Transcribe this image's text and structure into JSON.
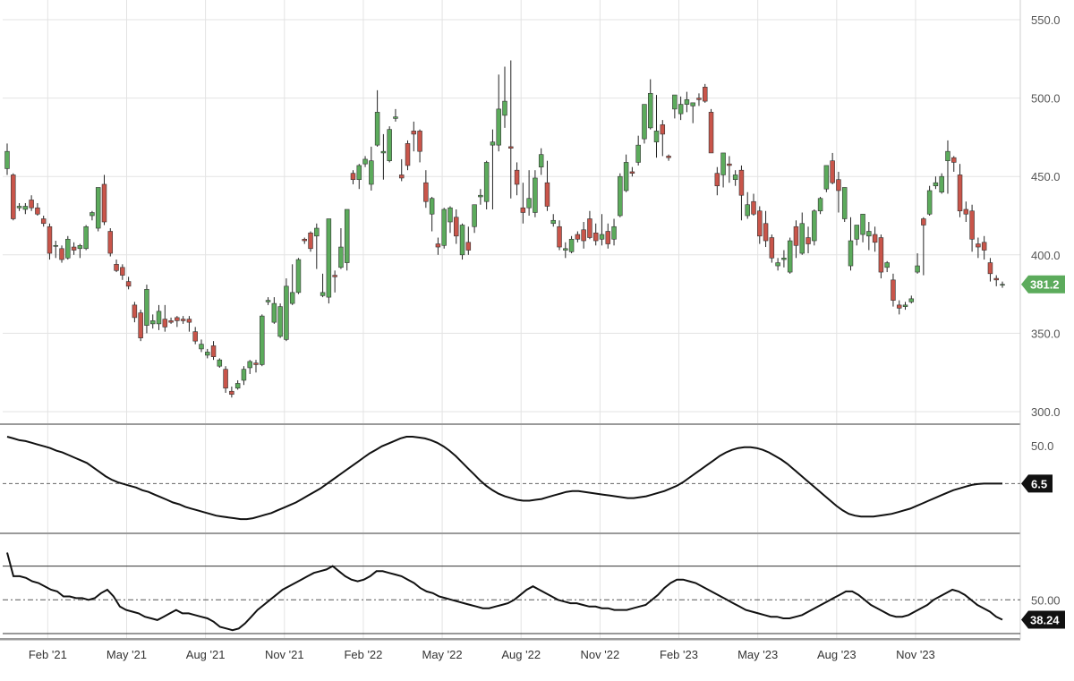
{
  "chart_data": {
    "type": "candlestick",
    "x_ticks": [
      "Feb '21",
      "May '21",
      "Aug '21",
      "Nov '21",
      "Feb '22",
      "May '22",
      "Aug '22",
      "Nov '22",
      "Feb '23",
      "May '23",
      "Aug '23",
      "Nov '23"
    ],
    "x_tick_week_index": [
      3,
      16,
      29,
      42,
      55,
      68,
      81,
      94,
      107,
      120,
      133,
      146
    ],
    "colors": {
      "up": "#5cab5c",
      "down": "#c9554a",
      "wick": "#222222",
      "grid": "#e3e3e3",
      "line": "#111111",
      "last_price_bg": "#5cab5c"
    },
    "price_panel": {
      "ylim": [
        300,
        550
      ],
      "y_ticks": [
        "550.0",
        "500.0",
        "450.0",
        "400.0",
        "350.0",
        "300.0"
      ],
      "last_price_label": "381.2",
      "weekly_candles": [
        [
          455,
          471,
          451,
          466
        ],
        [
          451,
          452,
          422,
          423
        ],
        [
          430,
          433,
          428,
          431
        ],
        [
          429,
          433,
          426,
          431
        ],
        [
          435,
          438,
          428,
          430
        ],
        [
          430,
          433,
          425,
          426
        ],
        [
          423,
          425,
          418,
          420
        ],
        [
          418,
          420,
          397,
          401
        ],
        [
          406,
          409,
          398,
          406
        ],
        [
          404,
          406,
          395,
          397
        ],
        [
          398,
          412,
          397,
          410
        ],
        [
          405,
          408,
          400,
          403
        ],
        [
          404,
          407,
          398,
          406
        ],
        [
          404,
          419,
          403,
          418
        ],
        [
          425,
          428,
          422,
          427
        ],
        [
          417,
          443,
          415,
          443
        ],
        [
          445,
          451,
          419,
          421
        ],
        [
          415,
          417,
          399,
          401
        ],
        [
          394,
          397,
          389,
          390
        ],
        [
          392,
          394,
          384,
          387
        ],
        [
          383,
          386,
          378,
          380
        ],
        [
          368,
          370,
          357,
          360
        ],
        [
          363,
          365,
          345,
          347
        ],
        [
          355,
          381,
          350,
          378
        ],
        [
          356,
          362,
          353,
          358
        ],
        [
          356,
          368,
          352,
          364
        ],
        [
          359,
          368,
          351,
          354
        ],
        [
          358,
          360,
          356,
          357
        ],
        [
          360,
          361,
          354,
          358
        ],
        [
          359,
          361,
          356,
          358
        ],
        [
          359,
          361,
          351,
          357
        ],
        [
          351,
          354,
          343,
          345
        ],
        [
          340,
          346,
          338,
          343
        ],
        [
          336,
          340,
          334,
          338
        ],
        [
          342,
          345,
          333,
          335
        ],
        [
          329,
          334,
          328,
          333
        ],
        [
          327,
          329,
          312,
          315
        ],
        [
          313,
          316,
          309,
          311
        ],
        [
          315,
          320,
          314,
          318
        ],
        [
          320,
          329,
          317,
          327
        ],
        [
          328,
          333,
          324,
          332
        ],
        [
          331,
          333,
          325,
          330
        ],
        [
          330,
          362,
          329,
          361
        ],
        [
          370,
          373,
          368,
          371
        ],
        [
          357,
          373,
          356,
          369
        ],
        [
          348,
          369,
          347,
          367
        ],
        [
          346,
          385,
          345,
          380
        ],
        [
          369,
          394,
          368,
          376
        ],
        [
          376,
          398,
          375,
          397
        ],
        [
          410,
          411,
          407,
          409
        ],
        [
          414,
          415,
          402,
          404
        ],
        [
          412,
          420,
          391,
          417
        ],
        [
          374,
          388,
          373,
          376
        ],
        [
          373,
          423,
          369,
          423
        ],
        [
          387,
          390,
          376,
          386
        ],
        [
          392,
          417,
          391,
          405
        ],
        [
          395,
          429,
          390,
          429
        ],
        [
          452,
          454,
          445,
          448
        ],
        [
          448,
          458,
          442,
          457
        ],
        [
          458,
          463,
          456,
          461
        ],
        [
          445,
          469,
          441,
          460
        ],
        [
          470,
          505,
          469,
          491
        ],
        [
          465,
          477,
          448,
          466
        ],
        [
          460,
          482,
          459,
          480
        ],
        [
          487,
          493,
          485,
          488
        ],
        [
          451,
          461,
          447,
          449
        ],
        [
          471,
          473,
          454,
          457
        ],
        [
          479,
          485,
          466,
          477
        ],
        [
          479,
          480,
          459,
          466
        ],
        [
          446,
          454,
          430,
          434
        ],
        [
          426,
          437,
          415,
          436
        ],
        [
          407,
          411,
          400,
          405
        ],
        [
          406,
          430,
          404,
          429
        ],
        [
          421,
          431,
          414,
          430
        ],
        [
          424,
          429,
          407,
          412
        ],
        [
          400,
          420,
          397,
          419
        ],
        [
          408,
          418,
          400,
          403
        ],
        [
          418,
          431,
          414,
          432
        ],
        [
          437,
          442,
          432,
          438
        ],
        [
          434,
          460,
          429,
          459
        ],
        [
          470,
          480,
          429,
          472
        ],
        [
          470,
          515,
          466,
          493
        ],
        [
          489,
          520,
          481,
          498
        ],
        [
          469,
          524,
          436,
          468
        ],
        [
          454,
          459,
          438,
          445
        ],
        [
          430,
          446,
          420,
          427
        ],
        [
          430,
          454,
          425,
          436
        ],
        [
          427,
          454,
          424,
          449
        ],
        [
          456,
          468,
          451,
          464
        ],
        [
          446,
          460,
          428,
          431
        ],
        [
          420,
          426,
          418,
          422
        ],
        [
          418,
          422,
          403,
          405
        ],
        [
          403,
          408,
          398,
          404
        ],
        [
          402,
          412,
          401,
          410
        ],
        [
          413,
          415,
          408,
          410
        ],
        [
          416,
          421,
          404,
          409
        ],
        [
          423,
          428,
          410,
          411
        ],
        [
          414,
          420,
          406,
          409
        ],
        [
          410,
          426,
          406,
          413
        ],
        [
          415,
          420,
          404,
          407
        ],
        [
          410,
          423,
          406,
          418
        ],
        [
          425,
          452,
          424,
          450
        ],
        [
          441,
          464,
          440,
          459
        ],
        [
          453,
          456,
          450,
          452
        ],
        [
          459,
          476,
          457,
          470
        ],
        [
          474,
          492,
          471,
          496
        ],
        [
          481,
          512,
          480,
          503
        ],
        [
          472,
          502,
          462,
          479
        ],
        [
          483,
          486,
          463,
          477
        ],
        [
          463,
          464,
          460,
          462
        ],
        [
          493,
          498,
          487,
          502
        ],
        [
          490,
          501,
          486,
          496
        ],
        [
          496,
          504,
          491,
          499
        ],
        [
          495,
          497,
          484,
          497
        ],
        [
          500,
          503,
          495,
          499
        ],
        [
          507,
          509,
          497,
          498
        ],
        [
          491,
          493,
          466,
          465
        ],
        [
          452,
          456,
          438,
          444
        ],
        [
          451,
          462,
          443,
          465
        ],
        [
          458,
          463,
          446,
          457
        ],
        [
          448,
          454,
          444,
          451
        ],
        [
          454,
          457,
          422,
          438
        ],
        [
          425,
          440,
          423,
          432
        ],
        [
          434,
          439,
          425,
          426
        ],
        [
          428,
          431,
          407,
          412
        ],
        [
          420,
          428,
          405,
          409
        ],
        [
          411,
          413,
          395,
          398
        ],
        [
          393,
          398,
          390,
          395
        ],
        [
          397,
          403,
          392,
          398
        ],
        [
          389,
          411,
          388,
          409
        ],
        [
          418,
          422,
          398,
          406
        ],
        [
          401,
          427,
          400,
          420
        ],
        [
          411,
          418,
          401,
          407
        ],
        [
          409,
          429,
          406,
          428
        ],
        [
          428,
          437,
          426,
          436
        ],
        [
          442,
          457,
          440,
          457
        ],
        [
          460,
          465,
          445,
          446
        ],
        [
          448,
          453,
          427,
          441
        ],
        [
          423,
          443,
          421,
          443
        ],
        [
          393,
          424,
          390,
          409
        ],
        [
          410,
          419,
          406,
          419
        ],
        [
          413,
          425,
          408,
          426
        ],
        [
          412,
          421,
          403,
          415
        ],
        [
          413,
          418,
          402,
          408
        ],
        [
          411,
          413,
          385,
          389
        ],
        [
          392,
          396,
          389,
          395
        ],
        [
          384,
          388,
          367,
          371
        ],
        [
          368,
          371,
          362,
          366
        ],
        [
          367,
          370,
          365,
          368
        ],
        [
          370,
          374,
          369,
          372
        ],
        [
          389,
          401,
          388,
          393
        ],
        [
          423,
          424,
          387,
          419
        ],
        [
          426,
          444,
          425,
          441
        ],
        [
          444,
          450,
          442,
          446
        ],
        [
          440,
          452,
          439,
          450
        ],
        [
          460,
          473,
          439,
          466
        ],
        [
          462,
          463,
          453,
          459
        ],
        [
          451,
          458,
          424,
          428
        ],
        [
          429,
          434,
          421,
          426
        ],
        [
          428,
          432,
          402,
          410
        ],
        [
          407,
          411,
          398,
          405
        ],
        [
          408,
          412,
          397,
          403
        ],
        [
          395,
          398,
          383,
          388
        ],
        [
          385,
          387,
          380,
          384
        ],
        [
          381,
          383,
          379,
          381.2
        ]
      ]
    },
    "indicator_1": {
      "y_ticks": [
        "50.0"
      ],
      "last_value_label": "6.5",
      "weekly_values": [
        60,
        58,
        56,
        55,
        53,
        51,
        49,
        47,
        44,
        42,
        39,
        36,
        33,
        30,
        25,
        20,
        15,
        11,
        8,
        6,
        4,
        2,
        -1,
        -3,
        -6,
        -9,
        -12,
        -15,
        -17,
        -20,
        -22,
        -24,
        -26,
        -28,
        -30,
        -31,
        -32,
        -33,
        -34,
        -34,
        -33,
        -31,
        -29,
        -27,
        -24,
        -21,
        -18,
        -15,
        -11,
        -7,
        -3,
        1,
        6,
        11,
        16,
        21,
        26,
        31,
        36,
        41,
        45,
        49,
        52,
        55,
        58,
        60,
        60,
        59,
        58,
        56,
        53,
        49,
        44,
        38,
        31,
        24,
        17,
        10,
        4,
        -1,
        -5,
        -8,
        -10,
        -12,
        -13,
        -13,
        -12,
        -11,
        -9,
        -7,
        -5,
        -3,
        -2,
        -2,
        -3,
        -4,
        -5,
        -6,
        -7,
        -8,
        -9,
        -10,
        -10,
        -9,
        -8,
        -6,
        -4,
        -2,
        1,
        4,
        8,
        13,
        18,
        23,
        28,
        33,
        38,
        42,
        45,
        47,
        48,
        48,
        47,
        45,
        42,
        38,
        34,
        29,
        23,
        17,
        11,
        5,
        -1,
        -7,
        -13,
        -19,
        -24,
        -28,
        -30,
        -31,
        -31,
        -31,
        -30,
        -29,
        -28,
        -26,
        -24,
        -22,
        -19,
        -16,
        -13,
        -10,
        -7,
        -4,
        -1,
        1,
        3,
        5,
        6,
        6.5,
        6.5,
        6.5,
        6.5
      ],
      "ylim": [
        -40,
        62
      ],
      "zero_value": 6.5
    },
    "indicator_2": {
      "y_ticks": [
        "50.00"
      ],
      "last_value_label": "38.24",
      "upper_band": 70,
      "mid_band": 50,
      "lower_band": 30,
      "ylim": [
        30,
        82
      ],
      "weekly_values": [
        78,
        64,
        64,
        63,
        61,
        60,
        58,
        56,
        55,
        52,
        52,
        51,
        51,
        50,
        51,
        54,
        56,
        52,
        46,
        44,
        43,
        42,
        40,
        39,
        38,
        40,
        42,
        44,
        42,
        42,
        41,
        40,
        39,
        37,
        34,
        33,
        32,
        33,
        36,
        40,
        44,
        47,
        50,
        53,
        56,
        58,
        60,
        62,
        64,
        66,
        67,
        68,
        70,
        67,
        64,
        62,
        61,
        62,
        64,
        67,
        67,
        66,
        65,
        64,
        62,
        60,
        57,
        55,
        54,
        52,
        51,
        50,
        49,
        48,
        47,
        46,
        45,
        45,
        46,
        47,
        48,
        50,
        53,
        56,
        58,
        56,
        54,
        52,
        50,
        49,
        48,
        48,
        47,
        46,
        46,
        45,
        45,
        44,
        44,
        44,
        45,
        46,
        47,
        50,
        53,
        57,
        60,
        62,
        62,
        61,
        60,
        58,
        56,
        54,
        52,
        50,
        48,
        46,
        44,
        43,
        42,
        41,
        40,
        40,
        39,
        39,
        40,
        41,
        43,
        45,
        47,
        49,
        51,
        53,
        55,
        55,
        53,
        50,
        47,
        45,
        43,
        41,
        40,
        40,
        41,
        43,
        45,
        47,
        50,
        52,
        54,
        56,
        55,
        53,
        50,
        47,
        45,
        43,
        40,
        38.24
      ]
    }
  }
}
